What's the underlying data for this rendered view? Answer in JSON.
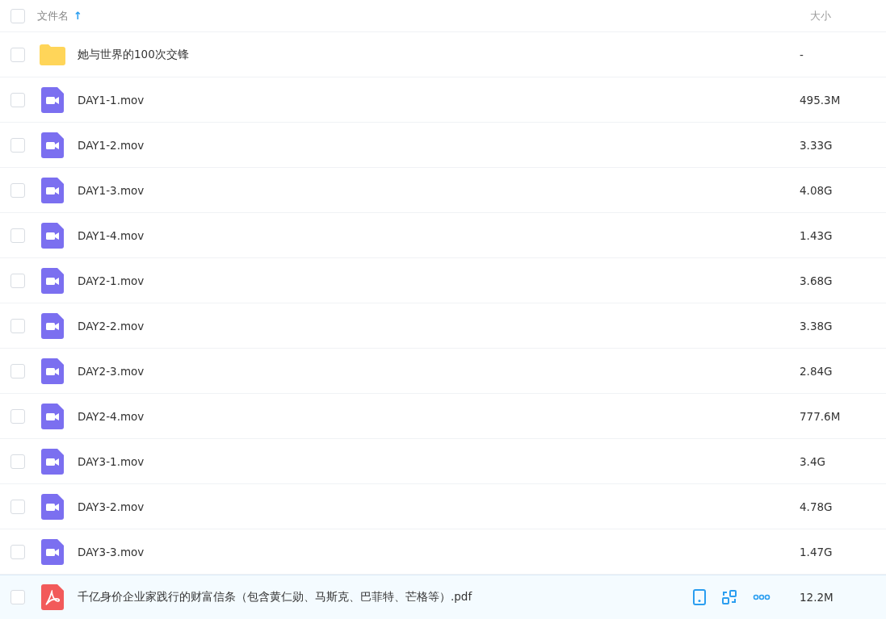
{
  "header": {
    "checked": false,
    "name_label": "文件名",
    "sort_arrow": "↑",
    "size_label": "大小"
  },
  "files": [
    {
      "kind": "folder",
      "name": "她与世界的100次交锋",
      "size": "-",
      "checked": false,
      "hovered": false
    },
    {
      "kind": "video",
      "name": "DAY1-1.mov",
      "size": "495.3M",
      "checked": false,
      "hovered": false
    },
    {
      "kind": "video",
      "name": "DAY1-2.mov",
      "size": "3.33G",
      "checked": false,
      "hovered": false
    },
    {
      "kind": "video",
      "name": "DAY1-3.mov",
      "size": "4.08G",
      "checked": false,
      "hovered": false
    },
    {
      "kind": "video",
      "name": "DAY1-4.mov",
      "size": "1.43G",
      "checked": false,
      "hovered": false
    },
    {
      "kind": "video",
      "name": "DAY2-1.mov",
      "size": "3.68G",
      "checked": false,
      "hovered": false
    },
    {
      "kind": "video",
      "name": "DAY2-2.mov",
      "size": "3.38G",
      "checked": false,
      "hovered": false
    },
    {
      "kind": "video",
      "name": "DAY2-3.mov",
      "size": "2.84G",
      "checked": false,
      "hovered": false
    },
    {
      "kind": "video",
      "name": "DAY2-4.mov",
      "size": "777.6M",
      "checked": false,
      "hovered": false
    },
    {
      "kind": "video",
      "name": "DAY3-1.mov",
      "size": "3.4G",
      "checked": false,
      "hovered": false
    },
    {
      "kind": "video",
      "name": "DAY3-2.mov",
      "size": "4.78G",
      "checked": false,
      "hovered": false
    },
    {
      "kind": "video",
      "name": "DAY3-3.mov",
      "size": "1.47G",
      "checked": false,
      "hovered": false
    },
    {
      "kind": "pdf",
      "name": "千亿身价企业家践行的财富信条（包含黄仁勋、马斯克、巴菲特、芒格等）.pdf",
      "size": "12.2M",
      "checked": false,
      "hovered": true
    }
  ]
}
